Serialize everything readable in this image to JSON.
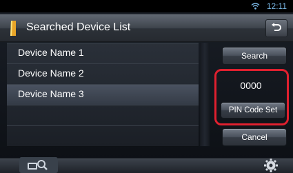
{
  "status": {
    "time": "12:11"
  },
  "header": {
    "title": "Searched Device List"
  },
  "devices": [
    {
      "label": "Device Name 1"
    },
    {
      "label": "Device Name 2"
    },
    {
      "label": "Device Name 3"
    }
  ],
  "buttons": {
    "search": "Search",
    "pin_code": "0000",
    "pin_set": "PIN Code Set",
    "cancel": "Cancel"
  },
  "icons": {
    "status": "wifi-icon",
    "title": "bluetooth-phone-icon",
    "back": "return-arrow-icon",
    "device_search": "device-search-icon",
    "settings": "gear-icon"
  },
  "colors": {
    "highlight_frame": "#e0202f",
    "clock": "#7ab8e6"
  }
}
